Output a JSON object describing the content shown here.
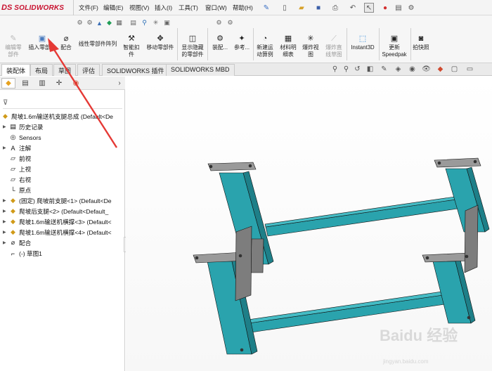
{
  "app": {
    "logo_ds": "DS",
    "logo_name": "SOLIDWORKS"
  },
  "menu": [
    {
      "label": "文件(F)"
    },
    {
      "label": "编辑(E)"
    },
    {
      "label": "视图(V)"
    },
    {
      "label": "插入(I)"
    },
    {
      "label": "工具(T)"
    },
    {
      "label": "窗口(W)"
    },
    {
      "label": "帮助(H)"
    }
  ],
  "quick_access_icons": [
    "pin-icon",
    "new-icon",
    "open-icon",
    "save-icon",
    "print-icon",
    "undo-icon",
    "select-icon",
    "rebuild-icon",
    "file-properties-icon",
    "options-icon"
  ],
  "ribbon": {
    "edit_part": "编辑零\n部件",
    "insert_part": "插入零部件",
    "mate": "配合",
    "linear_pattern": "线性零部件阵列",
    "smart_fastener": "智能扣\n件",
    "move_part": "移动零部件",
    "show_hidden": "显示隐藏\n的零部件",
    "assembly": "装配...",
    "reference": "参考...",
    "new_motion": "新建运\n动算例",
    "bom": "材料明\n细表",
    "explode": "爆炸视\n图",
    "explode_line": "爆炸直\n线草图",
    "instant3d": "Instant3D",
    "speedpak": "更新\nSpeedpak",
    "snapshot": "拍快照"
  },
  "tabs": [
    {
      "label": "装配体"
    },
    {
      "label": "布局"
    },
    {
      "label": "草图"
    },
    {
      "label": "评估"
    },
    {
      "label": "SOLIDWORKS 插件"
    },
    {
      "label": "SOLIDWORKS MBD"
    }
  ],
  "tree": {
    "root": "爬坡1.6m输送机支腿总成 (Default<De",
    "items": [
      {
        "label": "历史记录"
      },
      {
        "label": "Sensors"
      },
      {
        "label": "注解"
      },
      {
        "label": "前视"
      },
      {
        "label": "上视"
      },
      {
        "label": "右视"
      },
      {
        "label": "原点"
      },
      {
        "label": "(固定) 爬坡前支腿<1> (Default<De"
      },
      {
        "label": "爬坡后支腿<2> (Default<Default_"
      },
      {
        "label": "爬坡1.6m输送机横撑<3> (Default<"
      },
      {
        "label": "爬坡1.6m输送机横撑<4> (Default<"
      },
      {
        "label": "配合"
      },
      {
        "label": "(-) 草图1"
      }
    ]
  },
  "colors": {
    "frame_teal": "#2aa3ad",
    "frame_teal_dark": "#1e7f88",
    "frame_teal_light": "#45bcc5",
    "bracket_gray": "#7d7d7d",
    "plate_gray": "#9a9a9a",
    "arrow_red": "#e53935"
  },
  "watermark": {
    "text": "Baidu 经验",
    "url": "jingyan.baidu.com"
  }
}
